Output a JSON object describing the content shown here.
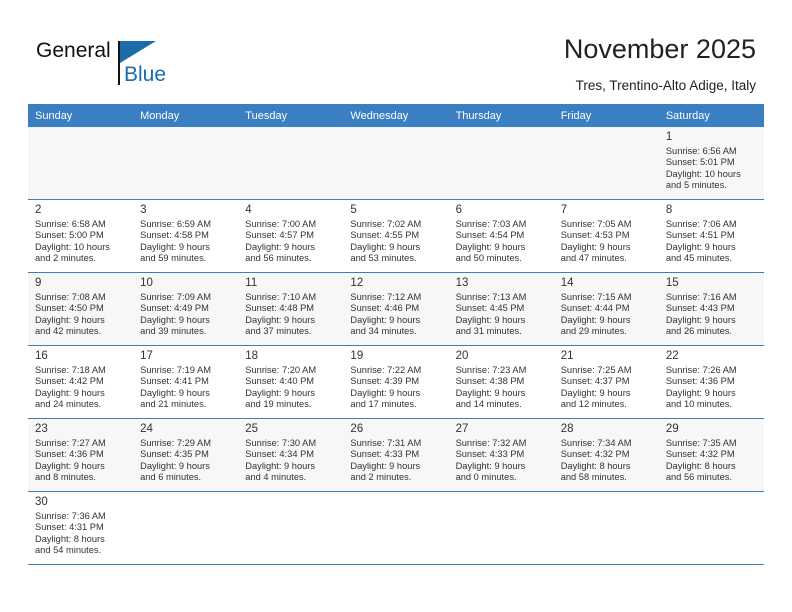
{
  "brand": {
    "line1": "General",
    "line2": "Blue",
    "accent_color": "#1b6ca8",
    "flag_icon": "brand-flag-icon"
  },
  "header": {
    "title": "November 2025",
    "subtitle": "Tres, Trentino-Alto Adige, Italy"
  },
  "calendar": {
    "header_bg": "#3a7fc1",
    "header_text_color": "#ffffff",
    "weekday_headers": [
      "Sunday",
      "Monday",
      "Tuesday",
      "Wednesday",
      "Thursday",
      "Friday",
      "Saturday"
    ],
    "weeks": [
      [
        {
          "day": ""
        },
        {
          "day": ""
        },
        {
          "day": ""
        },
        {
          "day": ""
        },
        {
          "day": ""
        },
        {
          "day": ""
        },
        {
          "day": "1",
          "sunrise": "Sunrise: 6:56 AM",
          "sunset": "Sunset: 5:01 PM",
          "daylight_line1": "Daylight: 10 hours",
          "daylight_line2": "and 5 minutes."
        }
      ],
      [
        {
          "day": "2",
          "sunrise": "Sunrise: 6:58 AM",
          "sunset": "Sunset: 5:00 PM",
          "daylight_line1": "Daylight: 10 hours",
          "daylight_line2": "and 2 minutes."
        },
        {
          "day": "3",
          "sunrise": "Sunrise: 6:59 AM",
          "sunset": "Sunset: 4:58 PM",
          "daylight_line1": "Daylight: 9 hours",
          "daylight_line2": "and 59 minutes."
        },
        {
          "day": "4",
          "sunrise": "Sunrise: 7:00 AM",
          "sunset": "Sunset: 4:57 PM",
          "daylight_line1": "Daylight: 9 hours",
          "daylight_line2": "and 56 minutes."
        },
        {
          "day": "5",
          "sunrise": "Sunrise: 7:02 AM",
          "sunset": "Sunset: 4:55 PM",
          "daylight_line1": "Daylight: 9 hours",
          "daylight_line2": "and 53 minutes."
        },
        {
          "day": "6",
          "sunrise": "Sunrise: 7:03 AM",
          "sunset": "Sunset: 4:54 PM",
          "daylight_line1": "Daylight: 9 hours",
          "daylight_line2": "and 50 minutes."
        },
        {
          "day": "7",
          "sunrise": "Sunrise: 7:05 AM",
          "sunset": "Sunset: 4:53 PM",
          "daylight_line1": "Daylight: 9 hours",
          "daylight_line2": "and 47 minutes."
        },
        {
          "day": "8",
          "sunrise": "Sunrise: 7:06 AM",
          "sunset": "Sunset: 4:51 PM",
          "daylight_line1": "Daylight: 9 hours",
          "daylight_line2": "and 45 minutes."
        }
      ],
      [
        {
          "day": "9",
          "sunrise": "Sunrise: 7:08 AM",
          "sunset": "Sunset: 4:50 PM",
          "daylight_line1": "Daylight: 9 hours",
          "daylight_line2": "and 42 minutes."
        },
        {
          "day": "10",
          "sunrise": "Sunrise: 7:09 AM",
          "sunset": "Sunset: 4:49 PM",
          "daylight_line1": "Daylight: 9 hours",
          "daylight_line2": "and 39 minutes."
        },
        {
          "day": "11",
          "sunrise": "Sunrise: 7:10 AM",
          "sunset": "Sunset: 4:48 PM",
          "daylight_line1": "Daylight: 9 hours",
          "daylight_line2": "and 37 minutes."
        },
        {
          "day": "12",
          "sunrise": "Sunrise: 7:12 AM",
          "sunset": "Sunset: 4:46 PM",
          "daylight_line1": "Daylight: 9 hours",
          "daylight_line2": "and 34 minutes."
        },
        {
          "day": "13",
          "sunrise": "Sunrise: 7:13 AM",
          "sunset": "Sunset: 4:45 PM",
          "daylight_line1": "Daylight: 9 hours",
          "daylight_line2": "and 31 minutes."
        },
        {
          "day": "14",
          "sunrise": "Sunrise: 7:15 AM",
          "sunset": "Sunset: 4:44 PM",
          "daylight_line1": "Daylight: 9 hours",
          "daylight_line2": "and 29 minutes."
        },
        {
          "day": "15",
          "sunrise": "Sunrise: 7:16 AM",
          "sunset": "Sunset: 4:43 PM",
          "daylight_line1": "Daylight: 9 hours",
          "daylight_line2": "and 26 minutes."
        }
      ],
      [
        {
          "day": "16",
          "sunrise": "Sunrise: 7:18 AM",
          "sunset": "Sunset: 4:42 PM",
          "daylight_line1": "Daylight: 9 hours",
          "daylight_line2": "and 24 minutes."
        },
        {
          "day": "17",
          "sunrise": "Sunrise: 7:19 AM",
          "sunset": "Sunset: 4:41 PM",
          "daylight_line1": "Daylight: 9 hours",
          "daylight_line2": "and 21 minutes."
        },
        {
          "day": "18",
          "sunrise": "Sunrise: 7:20 AM",
          "sunset": "Sunset: 4:40 PM",
          "daylight_line1": "Daylight: 9 hours",
          "daylight_line2": "and 19 minutes."
        },
        {
          "day": "19",
          "sunrise": "Sunrise: 7:22 AM",
          "sunset": "Sunset: 4:39 PM",
          "daylight_line1": "Daylight: 9 hours",
          "daylight_line2": "and 17 minutes."
        },
        {
          "day": "20",
          "sunrise": "Sunrise: 7:23 AM",
          "sunset": "Sunset: 4:38 PM",
          "daylight_line1": "Daylight: 9 hours",
          "daylight_line2": "and 14 minutes."
        },
        {
          "day": "21",
          "sunrise": "Sunrise: 7:25 AM",
          "sunset": "Sunset: 4:37 PM",
          "daylight_line1": "Daylight: 9 hours",
          "daylight_line2": "and 12 minutes."
        },
        {
          "day": "22",
          "sunrise": "Sunrise: 7:26 AM",
          "sunset": "Sunset: 4:36 PM",
          "daylight_line1": "Daylight: 9 hours",
          "daylight_line2": "and 10 minutes."
        }
      ],
      [
        {
          "day": "23",
          "sunrise": "Sunrise: 7:27 AM",
          "sunset": "Sunset: 4:36 PM",
          "daylight_line1": "Daylight: 9 hours",
          "daylight_line2": "and 8 minutes."
        },
        {
          "day": "24",
          "sunrise": "Sunrise: 7:29 AM",
          "sunset": "Sunset: 4:35 PM",
          "daylight_line1": "Daylight: 9 hours",
          "daylight_line2": "and 6 minutes."
        },
        {
          "day": "25",
          "sunrise": "Sunrise: 7:30 AM",
          "sunset": "Sunset: 4:34 PM",
          "daylight_line1": "Daylight: 9 hours",
          "daylight_line2": "and 4 minutes."
        },
        {
          "day": "26",
          "sunrise": "Sunrise: 7:31 AM",
          "sunset": "Sunset: 4:33 PM",
          "daylight_line1": "Daylight: 9 hours",
          "daylight_line2": "and 2 minutes."
        },
        {
          "day": "27",
          "sunrise": "Sunrise: 7:32 AM",
          "sunset": "Sunset: 4:33 PM",
          "daylight_line1": "Daylight: 9 hours",
          "daylight_line2": "and 0 minutes."
        },
        {
          "day": "28",
          "sunrise": "Sunrise: 7:34 AM",
          "sunset": "Sunset: 4:32 PM",
          "daylight_line1": "Daylight: 8 hours",
          "daylight_line2": "and 58 minutes."
        },
        {
          "day": "29",
          "sunrise": "Sunrise: 7:35 AM",
          "sunset": "Sunset: 4:32 PM",
          "daylight_line1": "Daylight: 8 hours",
          "daylight_line2": "and 56 minutes."
        }
      ],
      [
        {
          "day": "30",
          "sunrise": "Sunrise: 7:36 AM",
          "sunset": "Sunset: 4:31 PM",
          "daylight_line1": "Daylight: 8 hours",
          "daylight_line2": "and 54 minutes."
        },
        {
          "day": ""
        },
        {
          "day": ""
        },
        {
          "day": ""
        },
        {
          "day": ""
        },
        {
          "day": ""
        },
        {
          "day": ""
        }
      ]
    ]
  }
}
